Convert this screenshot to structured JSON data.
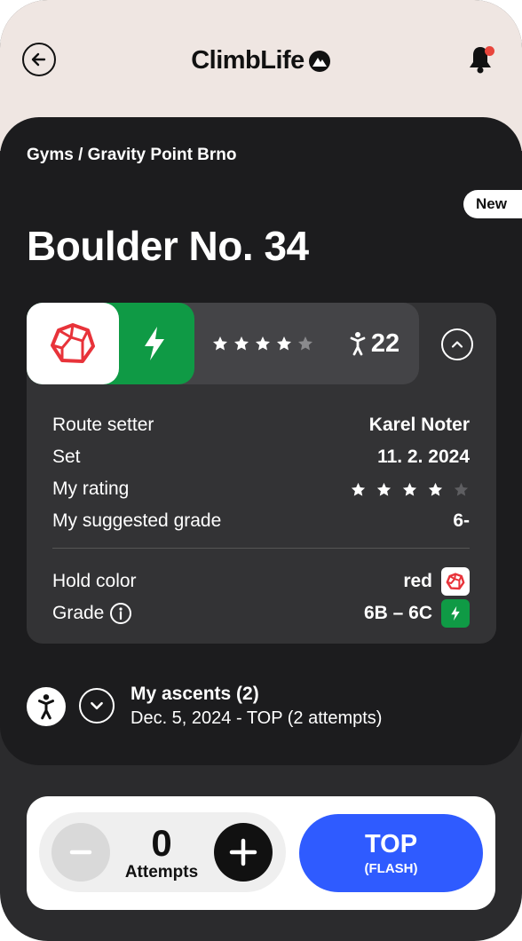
{
  "header": {
    "app_title": "ClimbLife",
    "back_icon": "arrow-left-icon",
    "notification_icon": "bell-icon",
    "has_unread": true
  },
  "breadcrumb": "Gyms / Gravity Point Brno",
  "badge": "New",
  "route": {
    "title": "Boulder No. 34",
    "hold_color_name": "red",
    "hold_color_hex": "#e8333a",
    "grade_color_hex": "#0f9a45",
    "rating_stars": 4,
    "rating_max": 5,
    "ascent_count": "22"
  },
  "details": {
    "route_setter_label": "Route setter",
    "route_setter_value": "Karel Noter",
    "set_label": "Set",
    "set_value": "11. 2. 2024",
    "my_rating_label": "My rating",
    "my_rating_stars": 4,
    "suggested_grade_label": "My suggested grade",
    "suggested_grade_value": "6-",
    "hold_color_label": "Hold color",
    "hold_color_value": "red",
    "grade_label": "Grade",
    "grade_value": "6B – 6C"
  },
  "ascents": {
    "title": "My ascents (2)",
    "latest": "Dec. 5, 2024 - TOP (2 attempts)"
  },
  "actions": {
    "attempts_value": "0",
    "attempts_label": "Attempts",
    "top_label": "TOP",
    "top_sublabel": "(FLASH)",
    "accent": "#2f5bff"
  }
}
